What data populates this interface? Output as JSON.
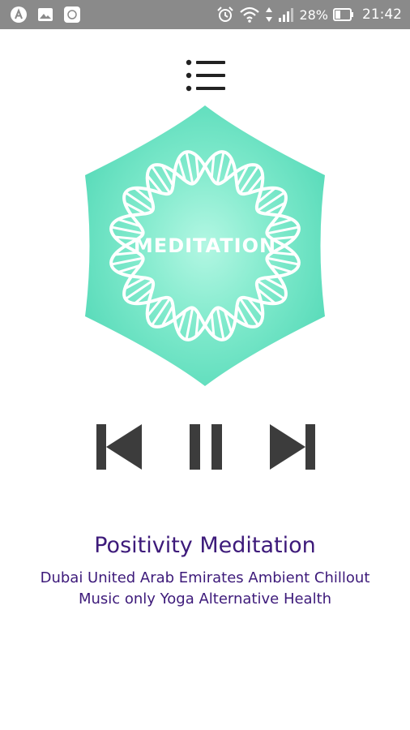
{
  "status_bar": {
    "battery": "28%",
    "time": "21:42",
    "icons": [
      "app-a-icon",
      "gallery-icon",
      "screenshot-icon",
      "alarm-icon",
      "wifi-icon",
      "signal-icon",
      "battery-icon"
    ]
  },
  "menu": {
    "icon": "playlist-menu-icon"
  },
  "artwork": {
    "label": "MEDITATION",
    "colors": {
      "hexagon": "#5fe0bf",
      "center": "#a6f5dd",
      "helix": "#ffffff"
    }
  },
  "controls": {
    "icons": [
      "skip-previous-icon",
      "pause-icon",
      "skip-next-icon"
    ],
    "color": "#3c3c3c"
  },
  "track": {
    "title": "Positivity Meditation",
    "subtitle_line1": "Dubai United Arab Emirates Ambient Chillout",
    "subtitle_line2": "Music only Yoga Alternative Health",
    "color": "#3d1a7a"
  }
}
